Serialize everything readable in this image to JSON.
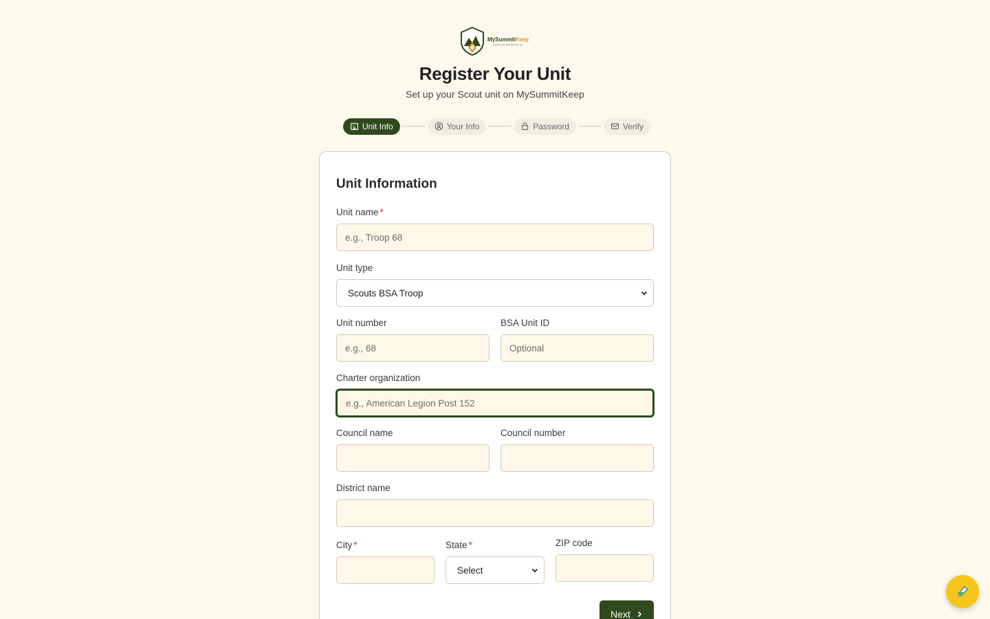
{
  "brand": {
    "name_part1": "MySummit",
    "name_part2": "Keep",
    "tagline": "Lead the unit. We'll keep the rest."
  },
  "page": {
    "title": "Register Your Unit",
    "subtitle": "Set up your Scout unit on MySummitKeep"
  },
  "steps": [
    {
      "label": "Unit Info",
      "icon": "building-icon",
      "active": true
    },
    {
      "label": "Your Info",
      "icon": "user-circle-icon",
      "active": false
    },
    {
      "label": "Password",
      "icon": "lock-icon",
      "active": false
    },
    {
      "label": "Verify",
      "icon": "mail-icon",
      "active": false
    }
  ],
  "form": {
    "title": "Unit Information",
    "unit_name": {
      "label": "Unit name",
      "required_mark": "*",
      "placeholder": "e.g., Troop 68"
    },
    "unit_type": {
      "label": "Unit type",
      "value": "Scouts BSA Troop"
    },
    "unit_number": {
      "label": "Unit number",
      "placeholder": "e.g., 68"
    },
    "bsa_unit_id": {
      "label": "BSA Unit ID",
      "placeholder": "Optional"
    },
    "charter_org": {
      "label": "Charter organization",
      "placeholder": "e.g., American Legion Post 152"
    },
    "council_name": {
      "label": "Council name",
      "placeholder": ""
    },
    "council_number": {
      "label": "Council number",
      "placeholder": ""
    },
    "district_name": {
      "label": "District name",
      "placeholder": ""
    },
    "city": {
      "label": "City",
      "required_mark": "*",
      "placeholder": ""
    },
    "state": {
      "label": "State",
      "required_mark": "*",
      "value": "Select"
    },
    "zip": {
      "label": "ZIP code",
      "placeholder": ""
    },
    "next_label": "Next"
  },
  "colors": {
    "brand_green": "#2f4a1c",
    "brand_orange": "#d4952a",
    "background": "#fdf9ed",
    "fab": "#f5c518"
  },
  "fab_icon": "test-tube-icon"
}
